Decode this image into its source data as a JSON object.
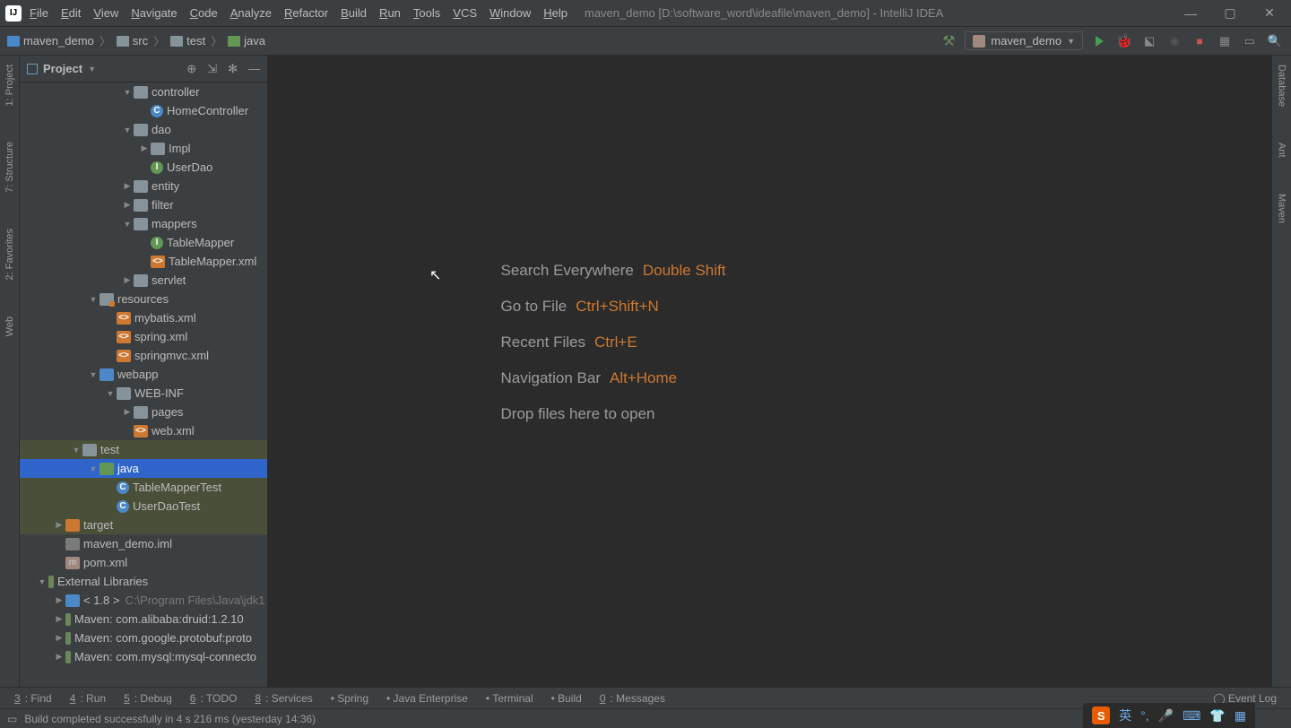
{
  "menubar": {
    "items": [
      "File",
      "Edit",
      "View",
      "Navigate",
      "Code",
      "Analyze",
      "Refactor",
      "Build",
      "Run",
      "Tools",
      "VCS",
      "Window",
      "Help"
    ],
    "title": "maven_demo [D:\\software_word\\ideafile\\maven_demo] - IntelliJ IDEA"
  },
  "breadcrumb": [
    "maven_demo",
    "src",
    "test",
    "java"
  ],
  "runConfig": "maven_demo",
  "projectPanel": {
    "label": "Project"
  },
  "leftGutter": [
    "1: Project",
    "7: Structure",
    "2: Favorites",
    "Web"
  ],
  "rightGutter": [
    "Database",
    "Ant",
    "Maven"
  ],
  "tree": [
    {
      "d": 5,
      "a": "open",
      "ic": "folder",
      "t": "controller"
    },
    {
      "d": 6,
      "a": "",
      "ic": "class",
      "il": "C",
      "t": "HomeController"
    },
    {
      "d": 5,
      "a": "open",
      "ic": "folder",
      "t": "dao"
    },
    {
      "d": 6,
      "a": "closed",
      "ic": "folder",
      "t": "Impl"
    },
    {
      "d": 6,
      "a": "",
      "ic": "iface",
      "il": "I",
      "t": "UserDao"
    },
    {
      "d": 5,
      "a": "closed",
      "ic": "folder",
      "t": "entity"
    },
    {
      "d": 5,
      "a": "closed",
      "ic": "folder",
      "t": "filter"
    },
    {
      "d": 5,
      "a": "open",
      "ic": "folder",
      "t": "mappers"
    },
    {
      "d": 6,
      "a": "",
      "ic": "iface",
      "il": "I",
      "t": "TableMapper"
    },
    {
      "d": 6,
      "a": "",
      "ic": "xml",
      "il": "<>",
      "t": "TableMapper.xml"
    },
    {
      "d": 5,
      "a": "closed",
      "ic": "folder",
      "t": "servlet"
    },
    {
      "d": 3,
      "a": "open",
      "ic": "folder-res",
      "t": "resources"
    },
    {
      "d": 4,
      "a": "",
      "ic": "xml",
      "il": "<>",
      "t": "mybatis.xml"
    },
    {
      "d": 4,
      "a": "",
      "ic": "xml",
      "il": "<>",
      "t": "spring.xml"
    },
    {
      "d": 4,
      "a": "",
      "ic": "xml",
      "il": "<>",
      "t": "springmvc.xml"
    },
    {
      "d": 3,
      "a": "open",
      "ic": "folder-web",
      "t": "webapp"
    },
    {
      "d": 4,
      "a": "open",
      "ic": "folder",
      "t": "WEB-INF"
    },
    {
      "d": 5,
      "a": "closed",
      "ic": "folder",
      "t": "pages"
    },
    {
      "d": 5,
      "a": "",
      "ic": "xml",
      "il": "<>",
      "t": "web.xml"
    },
    {
      "d": 2,
      "a": "open",
      "ic": "folder",
      "t": "test",
      "hl": true
    },
    {
      "d": 3,
      "a": "open",
      "ic": "folder-green",
      "t": "java",
      "sel": true
    },
    {
      "d": 4,
      "a": "",
      "ic": "class",
      "il": "C",
      "t": "TableMapperTest",
      "hl": true
    },
    {
      "d": 4,
      "a": "",
      "ic": "class",
      "il": "C",
      "t": "UserDaoTest",
      "hl": true
    },
    {
      "d": 1,
      "a": "closed",
      "ic": "folder-orange",
      "t": "target",
      "hl": true
    },
    {
      "d": 1,
      "a": "",
      "ic": "iml",
      "t": "maven_demo.iml"
    },
    {
      "d": 1,
      "a": "",
      "ic": "maven",
      "il": "m",
      "t": "pom.xml"
    },
    {
      "d": 0,
      "a": "open",
      "ic": "lib",
      "t": "External Libraries"
    },
    {
      "d": 1,
      "a": "closed",
      "ic": "jdk",
      "t": "< 1.8 >",
      "dim": "C:\\Program Files\\Java\\jdk1"
    },
    {
      "d": 1,
      "a": "closed",
      "ic": "lib",
      "t": "Maven: com.alibaba:druid:1.2.10"
    },
    {
      "d": 1,
      "a": "closed",
      "ic": "lib",
      "t": "Maven: com.google.protobuf:proto"
    },
    {
      "d": 1,
      "a": "closed",
      "ic": "lib",
      "t": "Maven: com.mysql:mysql-connecto"
    }
  ],
  "hints": [
    {
      "label": "Search Everywhere",
      "shortcut": "Double Shift"
    },
    {
      "label": "Go to File",
      "shortcut": "Ctrl+Shift+N"
    },
    {
      "label": "Recent Files",
      "shortcut": "Ctrl+E"
    },
    {
      "label": "Navigation Bar",
      "shortcut": "Alt+Home"
    },
    {
      "label": "Drop files here to open",
      "shortcut": ""
    }
  ],
  "bottomTabs": [
    {
      "n": "3",
      "l": "Find"
    },
    {
      "n": "4",
      "l": "Run"
    },
    {
      "n": "5",
      "l": "Debug"
    },
    {
      "n": "6",
      "l": "TODO"
    },
    {
      "n": "8",
      "l": "Services"
    },
    {
      "n": "",
      "l": "Spring"
    },
    {
      "n": "",
      "l": "Java Enterprise"
    },
    {
      "n": "",
      "l": "Terminal"
    },
    {
      "n": "",
      "l": "Build"
    },
    {
      "n": "0",
      "l": "Messages"
    }
  ],
  "eventLog": "Event Log",
  "status": "Build completed successfully in 4 s 216 ms (yesterday 14:36)",
  "ime": {
    "lang": "英"
  }
}
